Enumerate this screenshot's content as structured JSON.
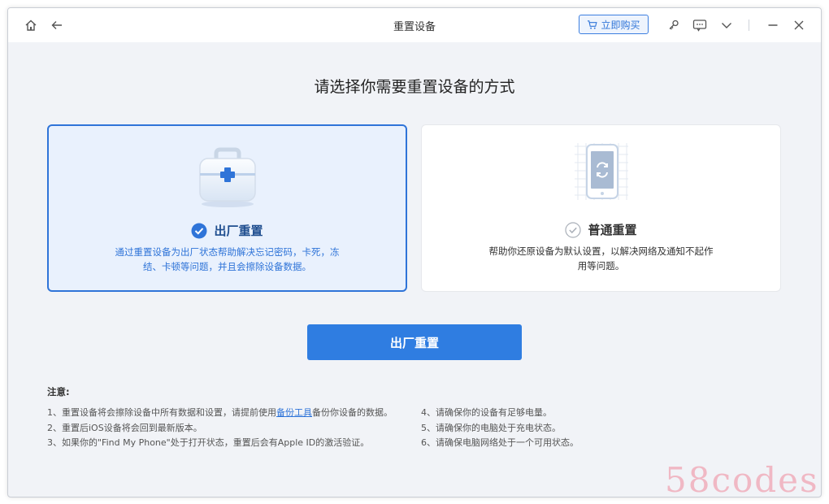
{
  "window": {
    "title": "重置设备",
    "buy_label": "立即购买"
  },
  "main": {
    "heading": "请选择你需要重置设备的方式",
    "options": [
      {
        "title": "出厂重置",
        "desc_line1": "通过重置设备为出厂状态帮助解决忘记密码，卡死，冻",
        "desc_line2": "结、卡顿等问题，并且会擦除设备数据。",
        "selected": true
      },
      {
        "title": "普通重置",
        "desc_line1": "帮助你还原设备为默认设置，以解决网络及通知不起作",
        "desc_line2": "用等问题。",
        "selected": false
      }
    ],
    "button_label": "出厂重置"
  },
  "notes": {
    "title": "注意:",
    "n1_pre": "1、重置设备将会擦除设备中所有数据和设置，请提前使用",
    "n1_link": "备份工具",
    "n1_post": "备份你设备的数据。",
    "n2": "2、重置后iOS设备将会回到最新版本。",
    "n3": "3、如果你的\"Find My Phone\"处于打开状态，重置后会有Apple ID的激活验证。",
    "n4": "4、请确保你的设备有足够电量。",
    "n5": "5、请确保你的电脑处于充电状态。",
    "n6": "6、请确保电脑网络处于一个可用状态。"
  },
  "watermark": "58codes",
  "colors": {
    "accent": "#2f74d8",
    "button": "#2f7de1",
    "selected_bg": "#e9f1fd",
    "background": "#f1f3f7"
  }
}
